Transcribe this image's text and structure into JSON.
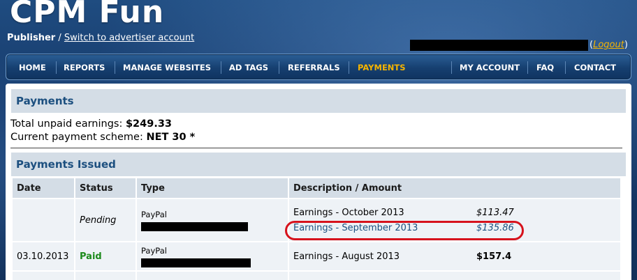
{
  "site": {
    "logo": "CPM Fun"
  },
  "account": {
    "role": "Publisher",
    "separator": "/",
    "switch_link": "Switch to advertiser account",
    "logout": "Logout",
    "logout_open": "(",
    "logout_close": ")"
  },
  "nav": {
    "items": [
      "HOME",
      "REPORTS",
      "MANAGE WEBSITES",
      "AD TAGS",
      "REFERRALS",
      "PAYMENTS",
      "MY ACCOUNT",
      "FAQ",
      "CONTACT"
    ],
    "active": "PAYMENTS"
  },
  "payments": {
    "title": "Payments",
    "unpaid_label": "Total unpaid earnings:",
    "unpaid_value": "$249.33",
    "scheme_label": "Current payment scheme:",
    "scheme_value": "NET 30 *"
  },
  "issued": {
    "title": "Payments Issued",
    "columns": [
      "Date",
      "Status",
      "Type",
      "Description / Amount"
    ],
    "rows": [
      {
        "date": "",
        "status": "Pending",
        "type": "PayPal",
        "items": [
          {
            "desc": "Earnings - October 2013",
            "amount": "$113.47"
          },
          {
            "desc": "Earnings - September 2013",
            "amount": "$135.86"
          }
        ]
      },
      {
        "date": "03.10.2013",
        "status": "Paid",
        "type": "PayPal",
        "items": [
          {
            "desc": "Earnings - August 2013",
            "amount": "$157.4"
          }
        ]
      }
    ]
  },
  "colors": {
    "accent": "#f5b400",
    "paid": "#1c8a1c",
    "header_text": "#1c4f7f",
    "highlight_circle": "#d6121c"
  }
}
